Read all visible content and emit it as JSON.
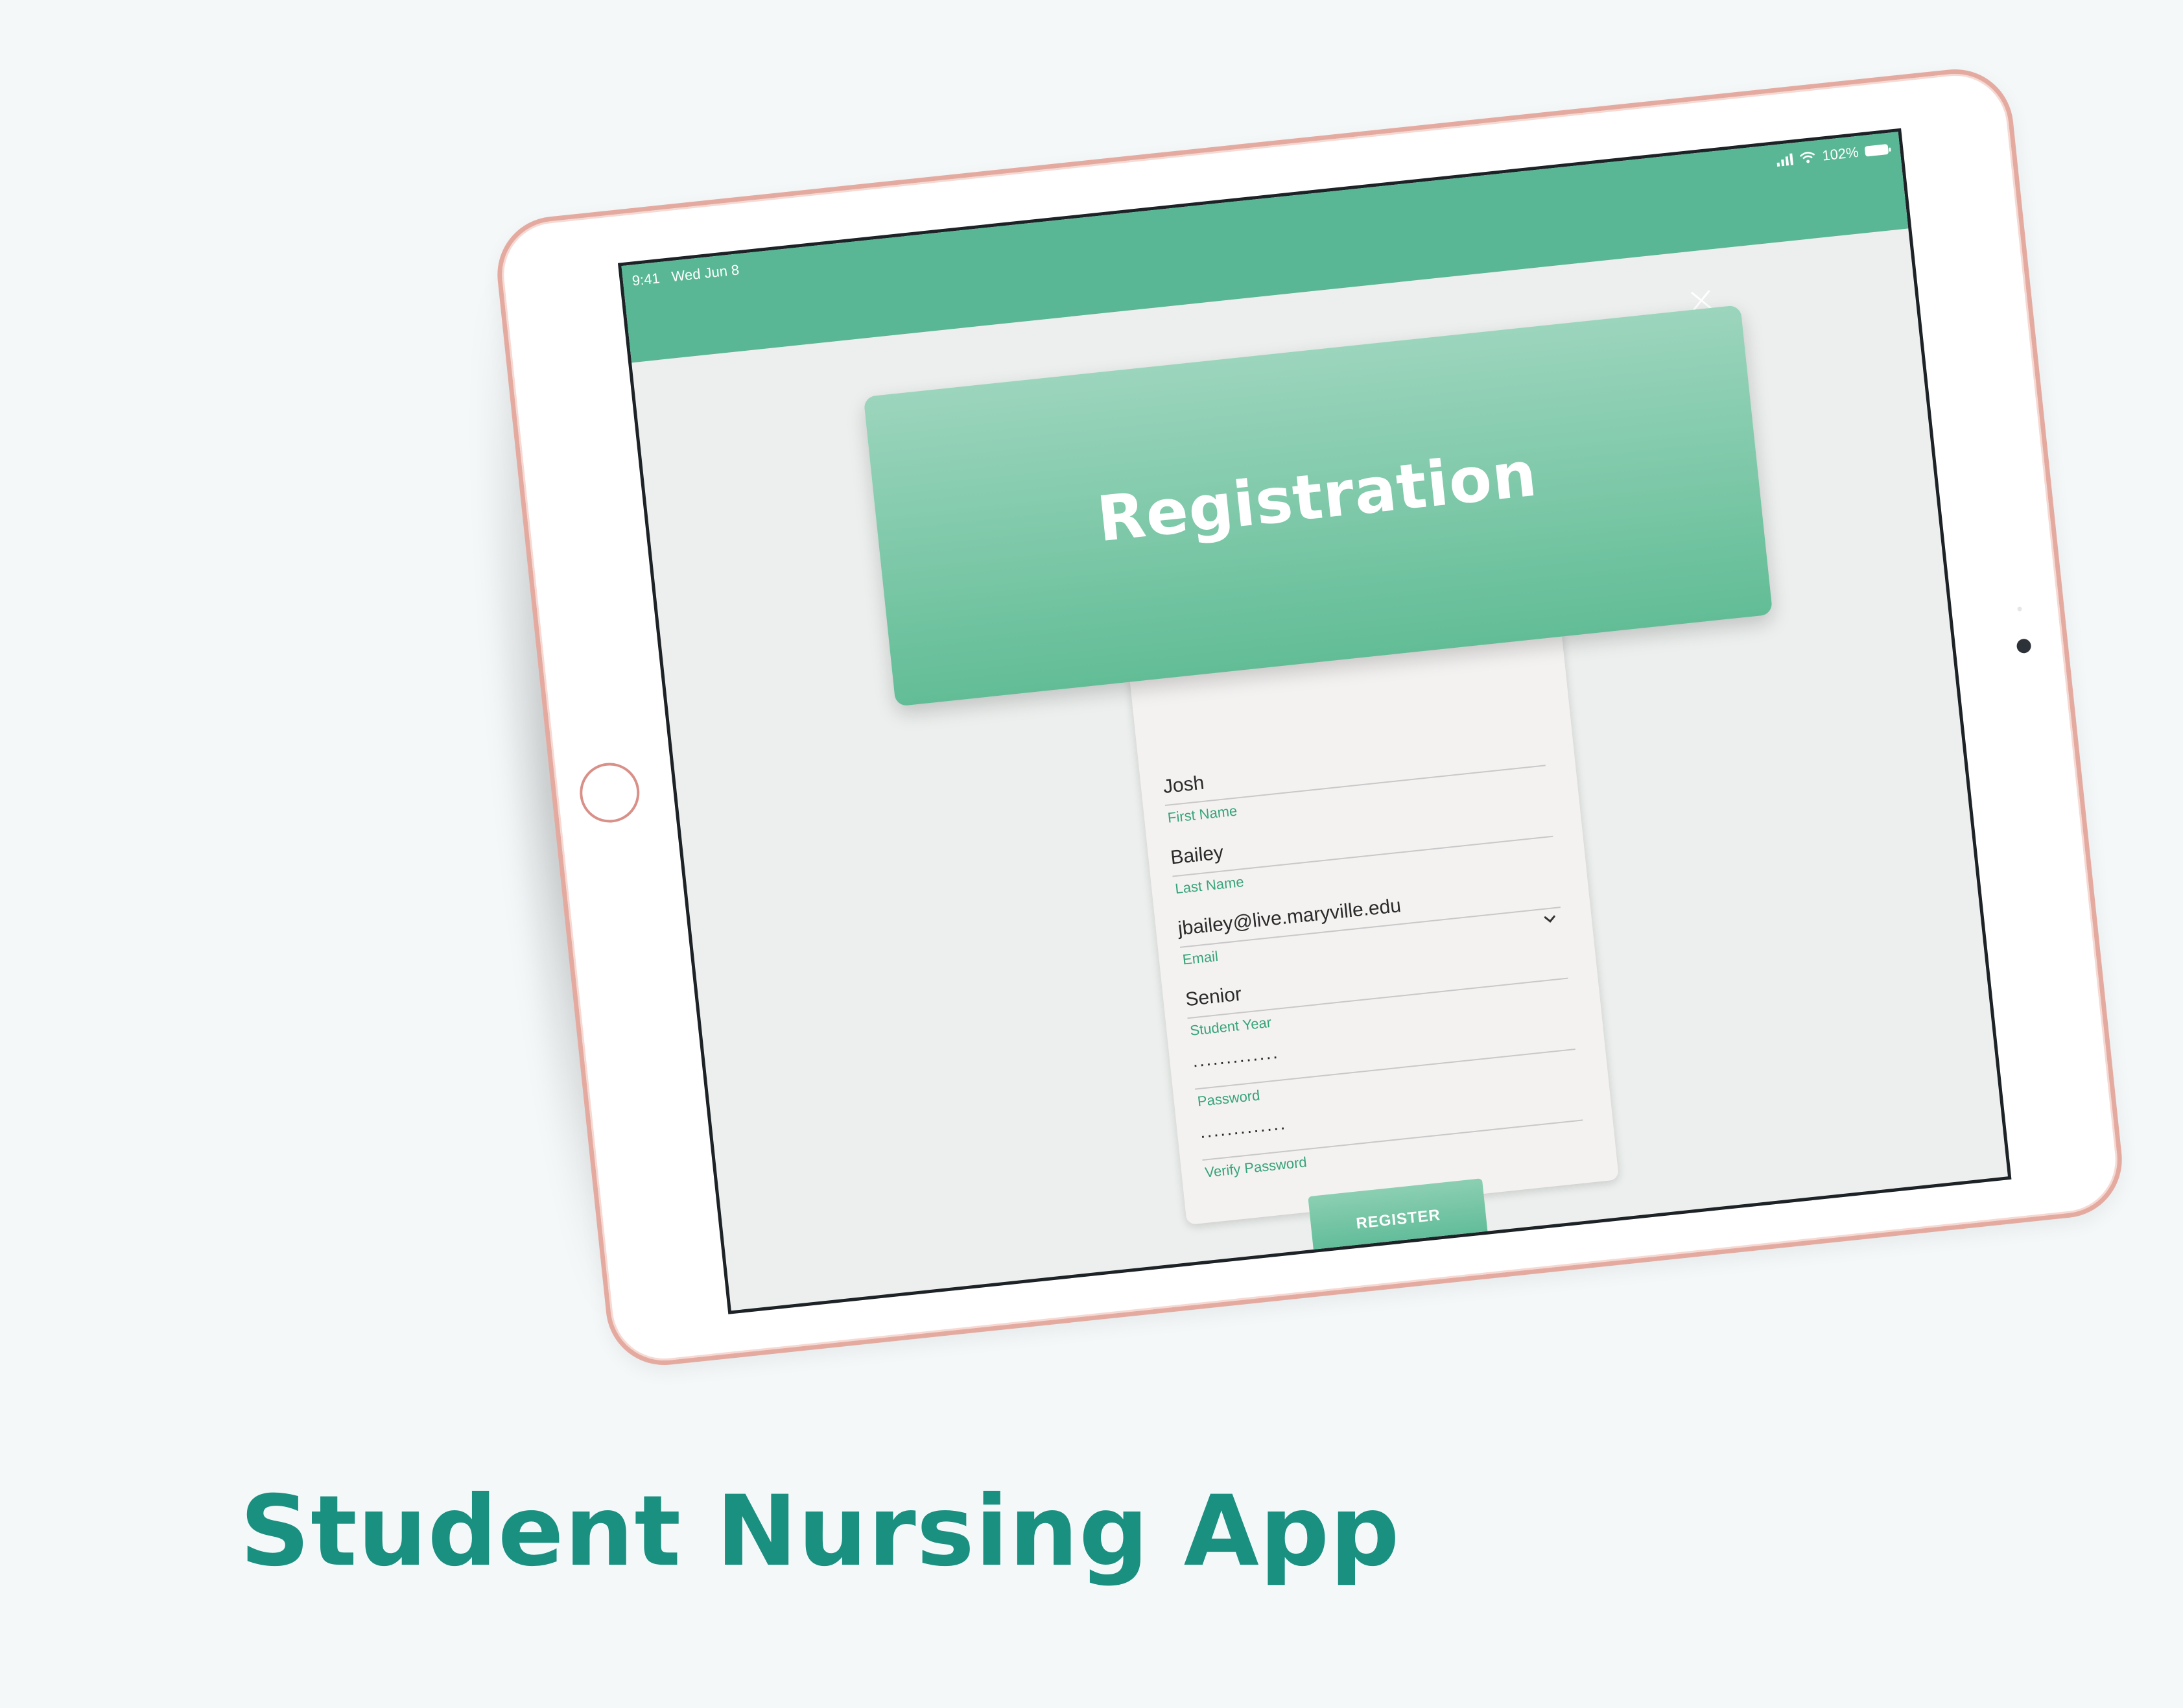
{
  "app_title": "Student Nursing App",
  "status_bar": {
    "time": "9:41",
    "date": "Wed Jun 8",
    "battery": "102%"
  },
  "registration": {
    "title": "Registration",
    "fields": [
      {
        "value": "Josh",
        "label": "First Name"
      },
      {
        "value": "Bailey",
        "label": "Last Name"
      },
      {
        "value": "jbailey@live.maryville.edu",
        "label": "Email"
      },
      {
        "value": "Senior",
        "label": "Student Year"
      },
      {
        "value": "·············",
        "label": "Password"
      },
      {
        "value": "·············",
        "label": "Verify Password"
      }
    ],
    "register_label": "REGISTER"
  },
  "colors": {
    "brand_green": "#59b795",
    "title_teal": "#1a9081",
    "bezel_rose": "#e4aaa0"
  },
  "icons": [
    "close-icon",
    "chevron-down-icon",
    "signal-icon",
    "wifi-icon",
    "battery-icon"
  ]
}
